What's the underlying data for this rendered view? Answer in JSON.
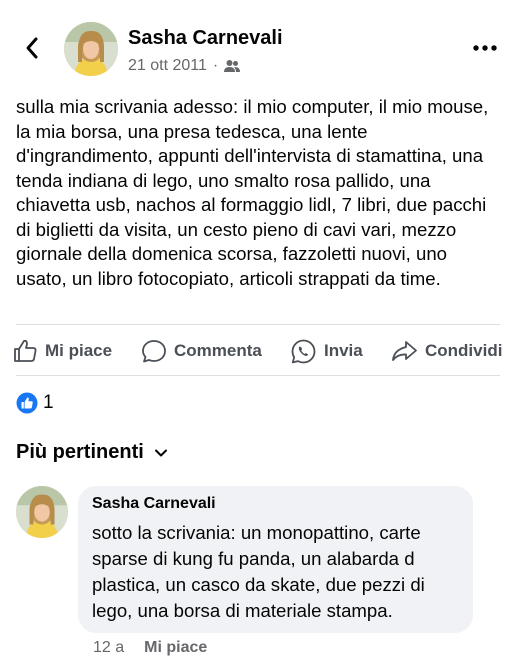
{
  "post": {
    "author": "Sasha Carnevali",
    "date": "21 ott 2011",
    "separator": "·",
    "audience_icon": "friends-icon",
    "text": "sulla mia scrivania adesso: il mio computer, il mio mouse, la mia borsa, una presa tedesca, una lente d'ingrandimento, appunti dell'intervista di stamattina, una tenda indiana di lego, uno smalto rosa pallido, una chiavetta usb, nachos al formaggio lidl, 7 libri, due pacchi di biglietti da visita, un cesto pieno di cavi vari, mezzo giornale della domenica scorsa, fazzoletti nuovi, uno usato, un libro fotocopiato, articoli strappati da time."
  },
  "actions": {
    "like": "Mi piace",
    "comment": "Commenta",
    "send": "Invia",
    "share": "Condividi"
  },
  "reactions": {
    "icon": "like-reaction-icon",
    "count": "1"
  },
  "comments_sort": {
    "label": "Più pertinenti"
  },
  "comment": {
    "author": "Sasha Carnevali",
    "text": "sotto la scrivania: un monopattino, carte sparse di kung fu panda, un alabarda d plastica, un casco da skate, due pezzi di lego, una borsa di materiale stampa.",
    "age": "12 a",
    "like": "Mi piace"
  },
  "colors": {
    "accent": "#1877f2",
    "muted": "#65676b",
    "bubble": "#f0f2f5"
  }
}
